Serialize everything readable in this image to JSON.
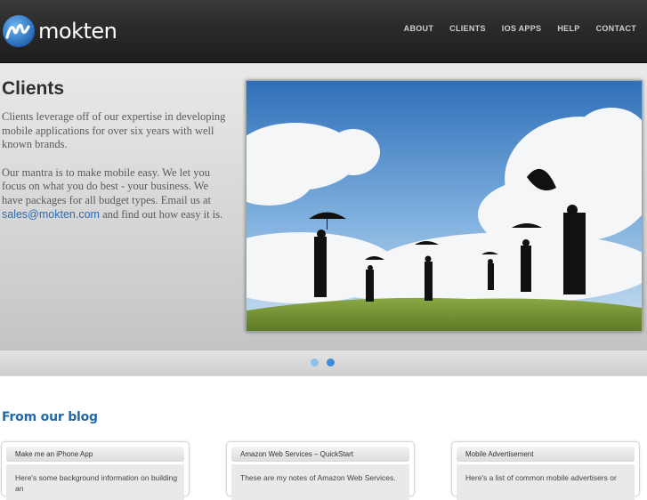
{
  "header": {
    "logo_text": "mokten",
    "nav": [
      {
        "label": "ABOUT"
      },
      {
        "label": "CLIENTS"
      },
      {
        "label": "IOS APPS"
      },
      {
        "label": "HELP"
      },
      {
        "label": "CONTACT"
      }
    ]
  },
  "hero": {
    "title": "Clients",
    "paragraph1": "Clients leverage off of our expertise in developing mobile applications for over six years with well known brands.",
    "paragraph2_before": "Our mantra is to make mobile easy. We let you focus on what you do best - your business. We have packages for all budget types. Email us at",
    "paragraph2_link": "sales@mokten.com",
    "paragraph2_after": " and find out how easy it is."
  },
  "blog": {
    "title": "From our blog",
    "posts": [
      {
        "title": "Make me an iPhone App",
        "excerpt": "Here's some background information on building an"
      },
      {
        "title": "Amazon Web Services – QuickStart",
        "excerpt": "These are my notes of Amazon Web Services."
      },
      {
        "title": "Mobile Advertisement",
        "excerpt": "Here's a list of common mobile advertisers or"
      }
    ]
  },
  "colors": {
    "header_bg": "#2a2a2a",
    "accent_blue": "#1f69ad",
    "link": "#2a6db3",
    "slider_dot_active": "#3b8bd8",
    "slider_dot_inactive": "#8ec0ee"
  }
}
